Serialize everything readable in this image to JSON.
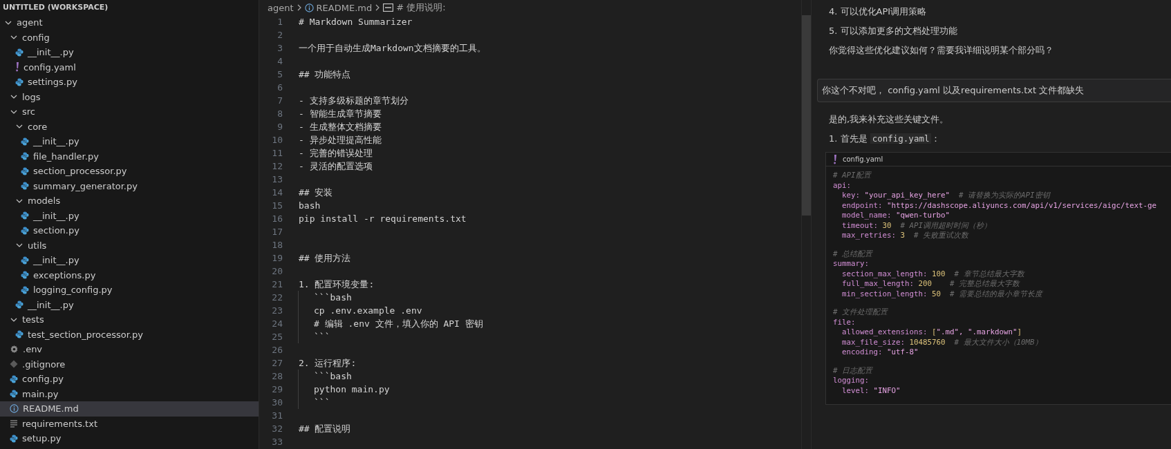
{
  "explorer": {
    "title": "UNTITLED (WORKSPACE)",
    "tree": [
      {
        "label": "agent",
        "kind": "folder",
        "expanded": true,
        "selected": false,
        "children": [
          {
            "label": "config",
            "kind": "folder",
            "expanded": true,
            "selected": false,
            "children": [
              {
                "label": "__init__.py",
                "kind": "python",
                "selected": false
              },
              {
                "label": "config.yaml",
                "kind": "yaml",
                "selected": false
              },
              {
                "label": "settings.py",
                "kind": "python",
                "selected": false
              }
            ]
          },
          {
            "label": "logs",
            "kind": "folder",
            "expanded": true,
            "selected": false
          },
          {
            "label": "src",
            "kind": "folder",
            "expanded": true,
            "selected": false,
            "children": [
              {
                "label": "core",
                "kind": "folder",
                "expanded": true,
                "selected": false,
                "children": [
                  {
                    "label": "__init__.py",
                    "kind": "python",
                    "selected": false
                  },
                  {
                    "label": "file_handler.py",
                    "kind": "python",
                    "selected": false
                  },
                  {
                    "label": "section_processor.py",
                    "kind": "python",
                    "selected": false
                  },
                  {
                    "label": "summary_generator.py",
                    "kind": "python",
                    "selected": false
                  }
                ]
              },
              {
                "label": "models",
                "kind": "folder",
                "expanded": true,
                "selected": false,
                "children": [
                  {
                    "label": "__init__.py",
                    "kind": "python",
                    "selected": false
                  },
                  {
                    "label": "section.py",
                    "kind": "python",
                    "selected": false
                  }
                ]
              },
              {
                "label": "utils",
                "kind": "folder",
                "expanded": true,
                "selected": false,
                "children": [
                  {
                    "label": "__init__.py",
                    "kind": "python",
                    "selected": false
                  },
                  {
                    "label": "exceptions.py",
                    "kind": "python",
                    "selected": false
                  },
                  {
                    "label": "logging_config.py",
                    "kind": "python",
                    "selected": false
                  }
                ]
              },
              {
                "label": "__init__.py",
                "kind": "python",
                "selected": false
              }
            ]
          },
          {
            "label": "tests",
            "kind": "folder",
            "expanded": true,
            "selected": false,
            "children": [
              {
                "label": "test_section_processor.py",
                "kind": "python",
                "selected": false
              }
            ]
          },
          {
            "label": ".env",
            "kind": "env",
            "selected": false
          },
          {
            "label": ".gitignore",
            "kind": "git",
            "selected": false
          },
          {
            "label": "config.py",
            "kind": "python",
            "selected": false
          },
          {
            "label": "main.py",
            "kind": "python",
            "selected": false
          },
          {
            "label": "README.md",
            "kind": "info",
            "selected": true
          },
          {
            "label": "requirements.txt",
            "kind": "text",
            "selected": false
          },
          {
            "label": "setup.py",
            "kind": "python",
            "selected": false
          }
        ]
      }
    ]
  },
  "editor": {
    "breadcrumb": [
      {
        "label": "agent",
        "kind": "folder"
      },
      {
        "label": "README.md",
        "kind": "info"
      },
      {
        "label": "# 使用说明:",
        "kind": "symbol"
      }
    ],
    "lines": [
      {
        "number": "1",
        "text": "# Markdown Summarizer"
      },
      {
        "number": "2"
      },
      {
        "number": "3",
        "text": "一个用于自动生成Markdown文档摘要的工具。"
      },
      {
        "number": "4"
      },
      {
        "number": "5",
        "text": "## 功能特点"
      },
      {
        "number": "6"
      },
      {
        "number": "7",
        "text": "- 支持多级标题的章节划分"
      },
      {
        "number": "8",
        "text": "- 智能生成章节摘要"
      },
      {
        "number": "9",
        "text": "- 生成整体文档摘要"
      },
      {
        "number": "10",
        "text": "- 异步处理提高性能"
      },
      {
        "number": "11",
        "text": "- 完善的错误处理"
      },
      {
        "number": "12",
        "text": "- 灵活的配置选项"
      },
      {
        "number": "13"
      },
      {
        "number": "14",
        "text": "## 安装"
      },
      {
        "number": "15",
        "text": "bash"
      },
      {
        "number": "16",
        "text": "pip install -r requirements.txt"
      },
      {
        "number": "17"
      },
      {
        "number": "18"
      },
      {
        "number": "19",
        "text": "## 使用方法"
      },
      {
        "number": "20"
      },
      {
        "number": "21",
        "text": "1. 配置环境变量:"
      },
      {
        "number": "22",
        "text": "```bash",
        "guide": true
      },
      {
        "number": "23",
        "text": "cp .env.example .env",
        "guide": true
      },
      {
        "number": "24",
        "text": "# 编辑 .env 文件，填入你的 API 密钥",
        "guide": true
      },
      {
        "number": "25",
        "text": "```",
        "guide": true
      },
      {
        "number": "26"
      },
      {
        "number": "27",
        "text": "2. 运行程序:"
      },
      {
        "number": "28",
        "text": "```bash",
        "guide": true
      },
      {
        "number": "29",
        "text": "python main.py",
        "guide": true
      },
      {
        "number": "30",
        "text": "```",
        "guide": true
      },
      {
        "number": "31"
      },
      {
        "number": "32",
        "text": "## 配置说明"
      },
      {
        "number": "33"
      }
    ]
  },
  "chat": {
    "messages": [
      {
        "kind": "text",
        "segments": [
          {
            "kind": "plain",
            "text": "4. 可以优化API调用策略"
          }
        ]
      },
      {
        "kind": "text",
        "segments": [
          {
            "kind": "plain",
            "text": "5. 可以添加更多的文档处理功能"
          }
        ]
      },
      {
        "kind": "text",
        "segments": [
          {
            "kind": "plain",
            "text": "你觉得这些优化建议如何？需要我详细说明某个部分吗？"
          }
        ]
      },
      {
        "kind": "user",
        "segments": [
          {
            "kind": "plain",
            "text": "你这个不对吧， config.yaml 以及requirements.txt 文件都缺失"
          }
        ]
      },
      {
        "kind": "text",
        "segments": [
          {
            "kind": "plain",
            "text": "是的,我来补充这些关键文件。"
          }
        ]
      },
      {
        "kind": "text",
        "segments": [
          {
            "kind": "plain",
            "text": "1. 首先是 "
          },
          {
            "kind": "code",
            "text": "config.yaml"
          },
          {
            "kind": "plain",
            "text": "："
          }
        ]
      },
      {
        "kind": "code",
        "filename": "config.yaml",
        "blocks": [
          [
            [
              {
                "kind": "comment",
                "text": "# API配置"
              }
            ],
            [
              {
                "kind": "key",
                "text": "api:"
              }
            ],
            [
              {
                "kind": "key",
                "text": "  key: "
              },
              {
                "kind": "string",
                "text": "\"your_api_key_here\""
              },
              {
                "kind": "comment",
                "text": "  # 请替换为实际的API密钥"
              }
            ],
            [
              {
                "kind": "key",
                "text": "  endpoint: "
              },
              {
                "kind": "string",
                "text": "\"https://dashscope.aliyuncs.com/api/v1/services/aigc/text-ge"
              }
            ],
            [
              {
                "kind": "key",
                "text": "  model_name: "
              },
              {
                "kind": "string",
                "text": "\"qwen-turbo\""
              }
            ],
            [
              {
                "kind": "key",
                "text": "  timeout: "
              },
              {
                "kind": "number",
                "text": "30"
              },
              {
                "kind": "comment",
                "text": "  # API调用超时时间（秒）"
              }
            ],
            [
              {
                "kind": "key",
                "text": "  max_retries: "
              },
              {
                "kind": "number",
                "text": "3"
              },
              {
                "kind": "comment",
                "text": "  # 失败重试次数"
              }
            ]
          ],
          [
            [
              {
                "kind": "comment",
                "text": "# 总结配置"
              }
            ],
            [
              {
                "kind": "key",
                "text": "summary:"
              }
            ],
            [
              {
                "kind": "key",
                "text": "  section_max_length: "
              },
              {
                "kind": "number",
                "text": "100"
              },
              {
                "kind": "comment",
                "text": "  # 章节总结最大字数"
              }
            ],
            [
              {
                "kind": "key",
                "text": "  full_max_length: "
              },
              {
                "kind": "number",
                "text": "200"
              },
              {
                "kind": "comment",
                "text": "    # 完整总结最大字数"
              }
            ],
            [
              {
                "kind": "key",
                "text": "  min_section_length: "
              },
              {
                "kind": "number",
                "text": "50"
              },
              {
                "kind": "comment",
                "text": "  # 需要总结的最小章节长度"
              }
            ]
          ],
          [
            [
              {
                "kind": "comment",
                "text": "# 文件处理配置"
              }
            ],
            [
              {
                "kind": "key",
                "text": "file:"
              }
            ],
            [
              {
                "kind": "key",
                "text": "  allowed_extensions: "
              },
              {
                "kind": "number",
                "text": "["
              },
              {
                "kind": "string",
                "text": "\".md\", \".markdown\""
              },
              {
                "kind": "number",
                "text": "]"
              }
            ],
            [
              {
                "kind": "key",
                "text": "  max_file_size: "
              },
              {
                "kind": "number",
                "text": "10485760"
              },
              {
                "kind": "comment",
                "text": "  # 最大文件大小（10MB）"
              }
            ],
            [
              {
                "kind": "key",
                "text": "  encoding: "
              },
              {
                "kind": "string",
                "text": "\"utf-8\""
              }
            ]
          ],
          [
            [
              {
                "kind": "comment",
                "text": "# 日志配置"
              }
            ],
            [
              {
                "kind": "key",
                "text": "logging:"
              }
            ],
            [
              {
                "kind": "key",
                "text": "  level: "
              },
              {
                "kind": "string",
                "text": "\"INFO\""
              }
            ]
          ]
        ]
      }
    ]
  }
}
